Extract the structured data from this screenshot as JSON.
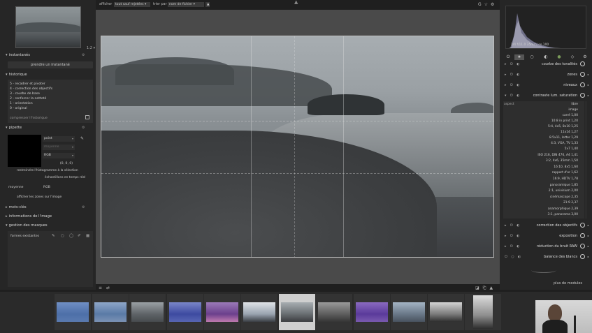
{
  "navigator": {
    "zoom": "1:2 ▾"
  },
  "left": {
    "snapshots": {
      "title": "instantanés",
      "button": "prendre un instantané"
    },
    "history": {
      "title": "historique",
      "items": [
        "5 - recadrer et pivoter",
        "4 - correction des objectifs",
        "3 - courbe de base",
        "2 - renforcer la netteté",
        "1 - orientation",
        "0 - original"
      ],
      "compress": "compresser l'historique"
    },
    "picker": {
      "title": "pipette",
      "mode": "point",
      "area": "moyenne",
      "colorspace": "RGB",
      "values": "(0, 0, 0)",
      "restrict": "restreindre l'histogramme à la sélection",
      "live": "échantillons en temps réel",
      "stat": "moyenne",
      "space2": "RGB",
      "show_zones": "afficher les zones sur l'image"
    },
    "tags": {
      "title": "mots-clés"
    },
    "image_info": {
      "title": "informations de l'image"
    },
    "masks": {
      "title": "gestion des masques",
      "existing": "formes existantes"
    }
  },
  "topbar": {
    "show_label": "afficher",
    "show_value": "tout sauf rejetées",
    "sort_label": "trier par",
    "sort_value": "nom de fichier"
  },
  "right": {
    "histogram_info": "1/4 f/11.0 35mm iso 100",
    "modules": [
      {
        "name": "courbe des tonalités"
      },
      {
        "name": "zones"
      },
      {
        "name": "niveaux"
      },
      {
        "name": "contraste lum. saturation"
      }
    ],
    "aspect": {
      "label": "aspect",
      "items": [
        "libre",
        "image",
        "carré 1,00",
        "10:8 in print 1,20",
        "5:4, 4x5, 8x10 1,25",
        "11x14 1,27",
        "8.5x11, letter 1,29",
        "4:3, VGA, TV 1,33",
        "5x7 1,40",
        "ISO 216, DIN 476, A4 1,41",
        "3:2, 4x6, 35mm 1,50",
        "16:10, 8x5 1,60",
        "rapport d'or 1,62",
        "16:9, HDTV 1,78",
        "panoramique 1,85",
        "2:1, univisium 2,00",
        "cinémascope 2,35",
        "21:9 2,37",
        "anamorphique 2,39",
        "3:1, panorama 3,00"
      ]
    },
    "modules_bottom": [
      {
        "name": "correction des objectifs"
      },
      {
        "name": "exposition"
      },
      {
        "name": "réduction du bruit RAW"
      },
      {
        "name": "balance des blancs"
      }
    ],
    "more_modules": "plus de modules"
  }
}
